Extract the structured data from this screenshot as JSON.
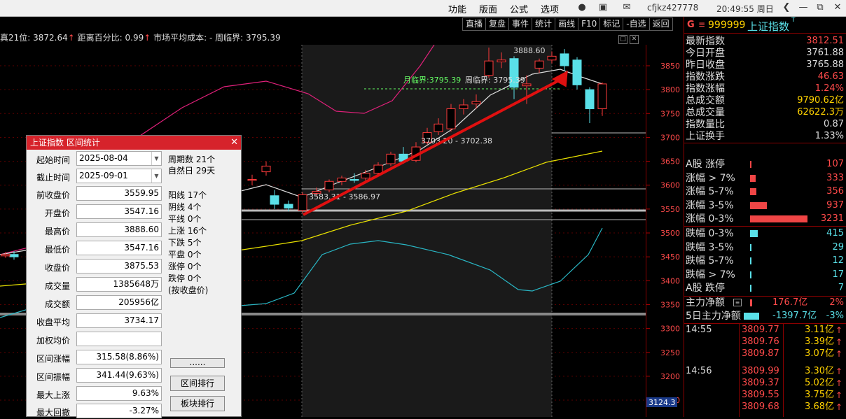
{
  "titlebar": {
    "menus": [
      "功能",
      "版面",
      "公式",
      "选项"
    ],
    "account": "cfjkz427778",
    "clock": "20:49:55 周日"
  },
  "toolbar": [
    "直播",
    "复盘",
    "事件",
    "统计",
    "画线",
    "F10",
    "标记",
    "-自选",
    "返回"
  ],
  "infobar": {
    "part1": "真21位: 3872.64",
    "arrow1": "↑",
    "part2": " 距离百分比: 0.99",
    "arrow2": "↑",
    "part3": " 市场平均成本: - 周临界: 3795.39"
  },
  "chart_data": {
    "type": "candlestick",
    "y_ticks": [
      3850,
      3800,
      3750,
      3700,
      3650,
      3600,
      3550,
      3500,
      3450,
      3400,
      3350,
      3300,
      3250,
      3200,
      3150
    ],
    "ylim": [
      3124.3,
      3900
    ],
    "last_label": "3124.3",
    "annotations": {
      "high": "3888.60",
      "month_critical": "月临界:3795.39",
      "week_critical": "周临界: 3795.39",
      "mid_range": "3703.20 - 3702.38",
      "low_range": "3583.31 - 3586.97"
    }
  },
  "dialog": {
    "title": "上证指数 区间统计",
    "fields": [
      {
        "label": "起始时间",
        "value": "2025-08-04",
        "date": true
      },
      {
        "label": "截止时间",
        "value": "2025-09-01",
        "date": true
      },
      {
        "label": "前收盘价",
        "value": "3559.95"
      },
      {
        "label": "开盘价",
        "value": "3547.16"
      },
      {
        "label": "最高价",
        "value": "3888.60"
      },
      {
        "label": "最低价",
        "value": "3547.16"
      },
      {
        "label": "收盘价",
        "value": "3875.53"
      },
      {
        "label": "成交量",
        "value": "1385648万"
      },
      {
        "label": "成交额",
        "value": "205956亿"
      },
      {
        "label": "收盘平均",
        "value": "3734.17"
      },
      {
        "label": "加权均价",
        "value": ""
      },
      {
        "label": "区间涨幅",
        "value": "315.58(8.86%)"
      },
      {
        "label": "区间振幅",
        "value": "341.44(9.63%)"
      },
      {
        "label": "最大上涨",
        "value": "9.63%"
      },
      {
        "label": "最大回撤",
        "value": "-3.27%"
      }
    ],
    "stats_top": [
      "周期数 21个",
      "自然日 29天"
    ],
    "stats": [
      "阳线 17个",
      "阴线 4个",
      "平线 0个",
      "上涨 16个",
      "下跌 5个",
      "平盘 0个",
      "涨停 0个",
      "跌停 0个",
      "(按收盘价)"
    ],
    "buttons": [
      "......",
      "区间排行",
      "板块排行"
    ]
  },
  "side": {
    "code": "999999",
    "name": "上证指数",
    "quote": [
      {
        "label": "最新指数",
        "value": "3812.51",
        "color": "#ff4a4a"
      },
      {
        "label": "今日开盘",
        "value": "3761.88",
        "color": "#dddddd"
      },
      {
        "label": "昨日收盘",
        "value": "3765.88",
        "color": "#dddddd"
      },
      {
        "label": "指数涨跌",
        "value": "46.63",
        "color": "#ff4a4a"
      },
      {
        "label": "指数涨幅",
        "value": "1.24%",
        "color": "#ff4a4a"
      },
      {
        "label": "总成交额",
        "value": "9790.62亿",
        "color": "#ffd200"
      },
      {
        "label": "总成交量",
        "value": "62622.3万",
        "color": "#ffd200"
      },
      {
        "label": "指数量比",
        "value": "0.87",
        "color": "#dddddd"
      },
      {
        "label": "上证换手",
        "value": "1.33%",
        "color": "#dddddd"
      }
    ],
    "breadth_up": [
      {
        "label": "A股 涨停",
        "value": "107",
        "frac": 0.03
      },
      {
        "label": "涨幅 > 7%",
        "value": "333",
        "frac": 0.1
      },
      {
        "label": "涨幅 5-7%",
        "value": "356",
        "frac": 0.11
      },
      {
        "label": "涨幅 3-5%",
        "value": "937",
        "frac": 0.29
      },
      {
        "label": "涨幅 0-3%",
        "value": "3231",
        "frac": 1.0
      }
    ],
    "breadth_down": [
      {
        "label": "跌幅 0-3%",
        "value": "415",
        "frac": 0.13
      },
      {
        "label": "跌幅 3-5%",
        "value": "29",
        "frac": 0.01
      },
      {
        "label": "跌幅 5-7%",
        "value": "12",
        "frac": 0.01
      },
      {
        "label": "跌幅 > 7%",
        "value": "17",
        "frac": 0.01
      },
      {
        "label": "A股 跌停",
        "value": "7",
        "frac": 0.005
      }
    ],
    "flow": [
      {
        "label": "主力净额",
        "value": "176.7亿",
        "pct": "2%",
        "color": "#ff4a4a"
      },
      {
        "label": "5日主力净额",
        "value": "-1397.7亿",
        "pct": "-3%",
        "color": "#5ae0e8"
      }
    ],
    "ticks": [
      {
        "time": "14:55",
        "price": "3809.77",
        "amt": "3.11亿"
      },
      {
        "time": "",
        "price": "3809.76",
        "amt": "3.39亿"
      },
      {
        "time": "",
        "price": "3809.87",
        "amt": "3.07亿"
      },
      {
        "time": "14:56",
        "price": "3809.99",
        "amt": "3.30亿"
      },
      {
        "time": "",
        "price": "3809.37",
        "amt": "5.02亿"
      },
      {
        "time": "",
        "price": "3809.55",
        "amt": "3.75亿"
      },
      {
        "time": "",
        "price": "3809.68",
        "amt": "3.68亿"
      }
    ]
  }
}
